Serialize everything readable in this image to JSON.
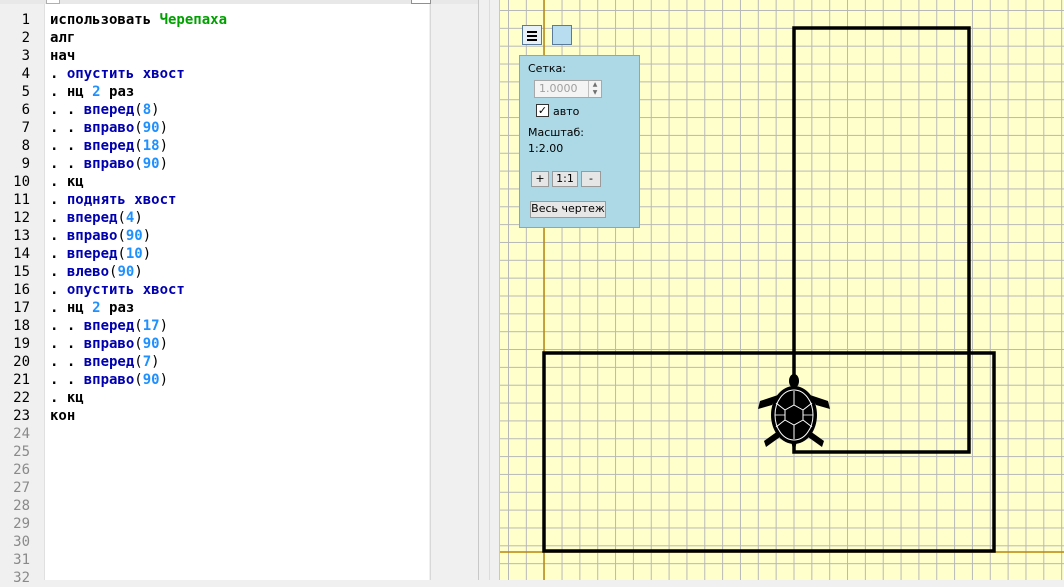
{
  "editor": {
    "line_numbers": [
      "1",
      "2",
      "3",
      "4",
      "5",
      "6",
      "7",
      "8",
      "9",
      "10",
      "11",
      "12",
      "13",
      "14",
      "15",
      "16",
      "17",
      "18",
      "19",
      "20",
      "21",
      "22",
      "23",
      "24",
      "25",
      "26",
      "27",
      "28",
      "29",
      "30",
      "31",
      "32"
    ],
    "lines": [
      [
        {
          "t": "использовать ",
          "c": "kw"
        },
        {
          "t": "Черепаха",
          "c": "mod"
        }
      ],
      [
        {
          "t": "алг",
          "c": "kw"
        }
      ],
      [
        {
          "t": "нач",
          "c": "kw"
        }
      ],
      [
        {
          "t": ". ",
          "c": "dot"
        },
        {
          "t": "опустить хвост",
          "c": "cmd"
        }
      ],
      [
        {
          "t": ". ",
          "c": "dot"
        },
        {
          "t": "нц ",
          "c": "kw"
        },
        {
          "t": "2",
          "c": "num"
        },
        {
          "t": " раз",
          "c": "kw"
        }
      ],
      [
        {
          "t": ". . ",
          "c": "dot"
        },
        {
          "t": "вперед",
          "c": "cmd"
        },
        {
          "t": "(",
          "c": "paren"
        },
        {
          "t": "8",
          "c": "num"
        },
        {
          "t": ")",
          "c": "paren"
        }
      ],
      [
        {
          "t": ". . ",
          "c": "dot"
        },
        {
          "t": "вправо",
          "c": "cmd"
        },
        {
          "t": "(",
          "c": "paren"
        },
        {
          "t": "90",
          "c": "num"
        },
        {
          "t": ")",
          "c": "paren"
        }
      ],
      [
        {
          "t": ". . ",
          "c": "dot"
        },
        {
          "t": "вперед",
          "c": "cmd"
        },
        {
          "t": "(",
          "c": "paren"
        },
        {
          "t": "18",
          "c": "num"
        },
        {
          "t": ")",
          "c": "paren"
        }
      ],
      [
        {
          "t": ". . ",
          "c": "dot"
        },
        {
          "t": "вправо",
          "c": "cmd"
        },
        {
          "t": "(",
          "c": "paren"
        },
        {
          "t": "90",
          "c": "num"
        },
        {
          "t": ")",
          "c": "paren"
        }
      ],
      [
        {
          "t": ". ",
          "c": "dot"
        },
        {
          "t": "кц",
          "c": "kw"
        }
      ],
      [
        {
          "t": ". ",
          "c": "dot"
        },
        {
          "t": "поднять хвост",
          "c": "cmd"
        }
      ],
      [
        {
          "t": ". ",
          "c": "dot"
        },
        {
          "t": "вперед",
          "c": "cmd"
        },
        {
          "t": "(",
          "c": "paren"
        },
        {
          "t": "4",
          "c": "num"
        },
        {
          "t": ")",
          "c": "paren"
        }
      ],
      [
        {
          "t": ". ",
          "c": "dot"
        },
        {
          "t": "вправо",
          "c": "cmd"
        },
        {
          "t": "(",
          "c": "paren"
        },
        {
          "t": "90",
          "c": "num"
        },
        {
          "t": ")",
          "c": "paren"
        }
      ],
      [
        {
          "t": ". ",
          "c": "dot"
        },
        {
          "t": "вперед",
          "c": "cmd"
        },
        {
          "t": "(",
          "c": "paren"
        },
        {
          "t": "10",
          "c": "num"
        },
        {
          "t": ")",
          "c": "paren"
        }
      ],
      [
        {
          "t": ". ",
          "c": "dot"
        },
        {
          "t": "влево",
          "c": "cmd"
        },
        {
          "t": "(",
          "c": "paren"
        },
        {
          "t": "90",
          "c": "num"
        },
        {
          "t": ")",
          "c": "paren"
        }
      ],
      [
        {
          "t": ". ",
          "c": "dot"
        },
        {
          "t": "опустить хвост",
          "c": "cmd"
        }
      ],
      [
        {
          "t": ". ",
          "c": "dot"
        },
        {
          "t": "нц ",
          "c": "kw"
        },
        {
          "t": "2",
          "c": "num"
        },
        {
          "t": " раз",
          "c": "kw"
        }
      ],
      [
        {
          "t": ". . ",
          "c": "dot"
        },
        {
          "t": "вперед",
          "c": "cmd"
        },
        {
          "t": "(",
          "c": "paren"
        },
        {
          "t": "17",
          "c": "num"
        },
        {
          "t": ")",
          "c": "paren"
        }
      ],
      [
        {
          "t": ". . ",
          "c": "dot"
        },
        {
          "t": "вправо",
          "c": "cmd"
        },
        {
          "t": "(",
          "c": "paren"
        },
        {
          "t": "90",
          "c": "num"
        },
        {
          "t": ")",
          "c": "paren"
        }
      ],
      [
        {
          "t": ". . ",
          "c": "dot"
        },
        {
          "t": "вперед",
          "c": "cmd"
        },
        {
          "t": "(",
          "c": "paren"
        },
        {
          "t": "7",
          "c": "num"
        },
        {
          "t": ")",
          "c": "paren"
        }
      ],
      [
        {
          "t": ". . ",
          "c": "dot"
        },
        {
          "t": "вправо",
          "c": "cmd"
        },
        {
          "t": "(",
          "c": "paren"
        },
        {
          "t": "90",
          "c": "num"
        },
        {
          "t": ")",
          "c": "paren"
        }
      ],
      [
        {
          "t": ". ",
          "c": "dot"
        },
        {
          "t": "кц",
          "c": "kw"
        }
      ],
      [
        {
          "t": "кон",
          "c": "kw"
        }
      ]
    ]
  },
  "turtle_panel": {
    "grid_label": "Сетка:",
    "grid_value": "1.0000",
    "auto_label": "авто",
    "auto_checked": true,
    "scale_label": "Масштаб:",
    "scale_value": "1:2.00",
    "zoom_in_label": "+",
    "zoom_reset_label": "1:1",
    "zoom_out_label": "-",
    "fit_all_label": "Весь чертеж"
  },
  "drawing": {
    "grid_step": 1,
    "shapes": [
      {
        "name": "tall-rectangle",
        "width": 10,
        "height": 24
      },
      {
        "name": "wide-rectangle",
        "width": 25,
        "height": 11
      }
    ],
    "turtle_icon": "turtle-icon"
  },
  "colors": {
    "keyword": "#000000",
    "command": "#0000b0",
    "number": "#1e90ff",
    "module": "#00a000",
    "canvas_bg": "#ffffcc",
    "grid": "#b8b8b8",
    "axis": "#b8860b",
    "panel_bg": "#add8e6"
  }
}
